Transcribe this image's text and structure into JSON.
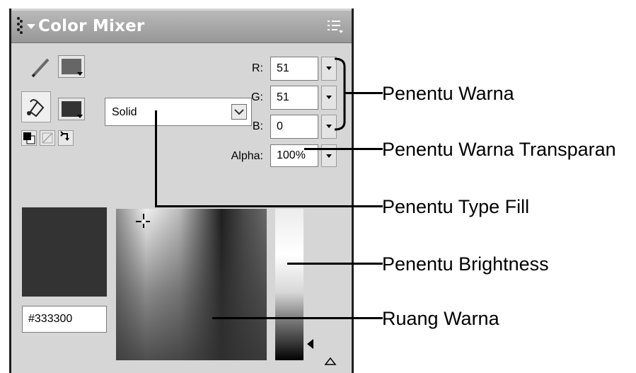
{
  "panel": {
    "title": "Color Mixer",
    "stroke_color": "#666666",
    "fill_color": "#333333",
    "fill_type": "Solid",
    "channels": [
      {
        "label": "R:",
        "value": "51"
      },
      {
        "label": "G:",
        "value": "51"
      },
      {
        "label": "B:",
        "value": "0"
      }
    ],
    "alpha": {
      "label": "Alpha:",
      "value": "100%"
    },
    "hex_value": "#333300",
    "preview_color": "#333333"
  },
  "callouts": {
    "penentu_warna": "Penentu Warna",
    "penentu_transparan": "Penentu Warna Transparan",
    "penentu_type_fill": "Penentu Type Fill",
    "penentu_brightness": "Penentu Brightness",
    "ruang_warna": "Ruang Warna"
  },
  "icons": {
    "pencil": "pencil-icon",
    "paint_bucket": "paint-bucket-icon",
    "black_white": "black-white-icon",
    "no_color": "no-color-icon",
    "swap": "swap-colors-icon",
    "options": "options-menu-icon"
  }
}
